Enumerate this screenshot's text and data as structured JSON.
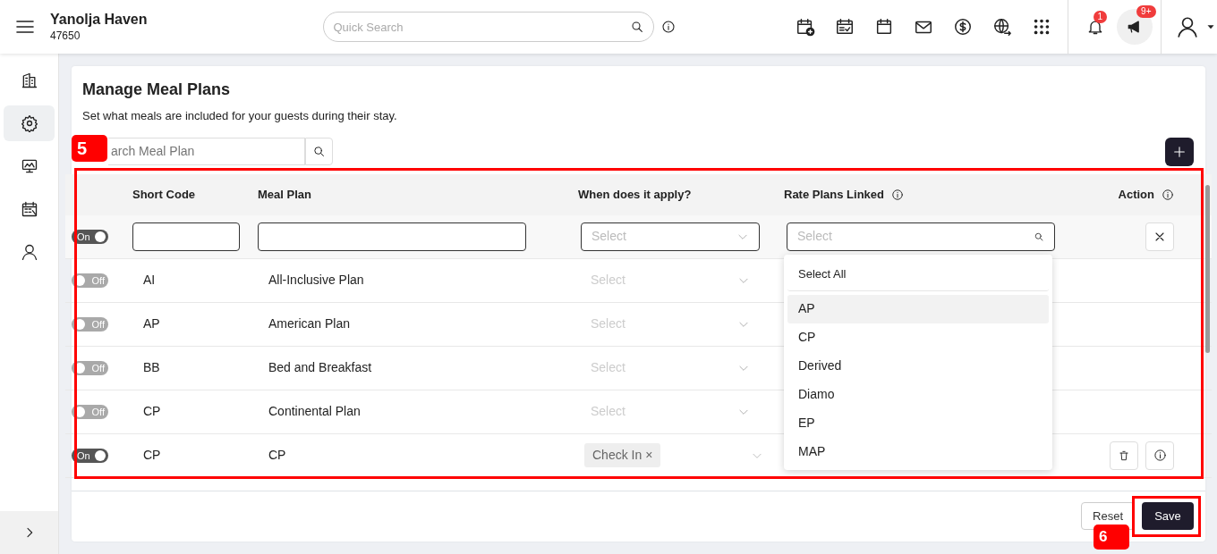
{
  "header": {
    "hotel_name": "Yanolja Haven",
    "hotel_id": "47650",
    "search": {
      "placeholder": "Quick Search"
    },
    "notification_count": "1",
    "announcement_count": "9+"
  },
  "sidebar": {
    "items": [
      {
        "kind": "building",
        "selected": false
      },
      {
        "kind": "gear",
        "selected": true
      },
      {
        "kind": "monitor",
        "selected": false
      },
      {
        "kind": "calendar",
        "selected": false
      },
      {
        "kind": "person",
        "selected": false
      }
    ]
  },
  "page": {
    "title": "Manage Meal Plans",
    "subtitle": "Set what meals are included for your guests during their stay.",
    "search": {
      "placeholder": "arch Meal Plan"
    }
  },
  "table": {
    "columns": [
      {
        "label": "Short Code",
        "info": false
      },
      {
        "label": "Meal Plan",
        "info": false
      },
      {
        "label": "When does it apply?",
        "info": false
      },
      {
        "label": "Rate Plans Linked",
        "info": true
      },
      {
        "label": "Action",
        "info": true
      }
    ],
    "new_row": {
      "on": true,
      "toggle_label": "On",
      "when_placeholder": "Select",
      "rate_placeholder": "Select"
    },
    "rows": [
      {
        "on": false,
        "toggle_label": "Off",
        "short_code": "AI",
        "meal_plan": "All-Inclusive Plan",
        "when_placeholder": "Select",
        "when_tags": [],
        "actions": false
      },
      {
        "on": false,
        "toggle_label": "Off",
        "short_code": "AP",
        "meal_plan": "American Plan",
        "when_placeholder": "Select",
        "when_tags": [],
        "actions": false
      },
      {
        "on": false,
        "toggle_label": "Off",
        "short_code": "BB",
        "meal_plan": "Bed and Breakfast",
        "when_placeholder": "Select",
        "when_tags": [],
        "actions": false
      },
      {
        "on": false,
        "toggle_label": "Off",
        "short_code": "CP",
        "meal_plan": "Continental Plan",
        "when_placeholder": "Select",
        "when_tags": [],
        "actions": false
      },
      {
        "on": true,
        "toggle_label": "On",
        "short_code": "CP",
        "meal_plan": "CP",
        "when_placeholder": "",
        "when_tags": [
          {
            "label": "Check In",
            "remove": "×"
          }
        ],
        "actions": true
      }
    ]
  },
  "dropdown": {
    "items": [
      {
        "label": "Select All",
        "kind": "all",
        "selected": false
      },
      {
        "label": "AP",
        "kind": "option",
        "selected": true
      },
      {
        "label": "CP",
        "kind": "option",
        "selected": false
      },
      {
        "label": "Derived",
        "kind": "option",
        "selected": false
      },
      {
        "label": "Diamo",
        "kind": "option",
        "selected": false
      },
      {
        "label": "EP",
        "kind": "option",
        "selected": false
      },
      {
        "label": "MAP",
        "kind": "option",
        "selected": false
      }
    ]
  },
  "footer": {
    "buttons": [
      {
        "label": "Reset",
        "kind": "secondary"
      },
      {
        "label": "Save",
        "kind": "primary"
      }
    ]
  },
  "annotations": [
    {
      "label": "5",
      "kind": "table"
    },
    {
      "label": "6",
      "kind": "save"
    }
  ]
}
